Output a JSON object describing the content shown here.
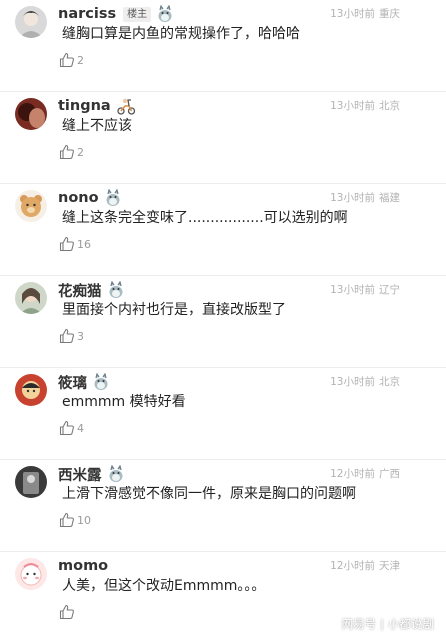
{
  "comments": [
    {
      "name": "narciss",
      "badge": "楼主",
      "time": "13小时前",
      "location": "重庆",
      "text": "缝胸口算是内鱼的常规操作了，哈哈哈",
      "likes": "2",
      "avatar": "avatar-face",
      "icon": "totoro-icon"
    },
    {
      "name": "tingna",
      "badge": "",
      "time": "13小时前",
      "location": "北京",
      "text": "缝上不应该",
      "likes": "2",
      "avatar": "avatar-photo",
      "icon": "scooter-icon"
    },
    {
      "name": "nono",
      "badge": "",
      "time": "13小时前",
      "location": "福建",
      "text": "缝上这条完全变味了.................可以选别的啊",
      "likes": "16",
      "avatar": "avatar-bear",
      "icon": "totoro-icon"
    },
    {
      "name": "花痴猫",
      "badge": "",
      "time": "13小时前",
      "location": "辽宁",
      "text": "里面接个内衬也行是，直接改版型了",
      "likes": "3",
      "avatar": "avatar-person",
      "icon": "totoro-icon"
    },
    {
      "name": "筱璃",
      "badge": "",
      "time": "13小时前",
      "location": "北京",
      "text": "emmmm 模特好看",
      "likes": "4",
      "avatar": "avatar-cartoon",
      "icon": "totoro-icon"
    },
    {
      "name": "西米露",
      "badge": "",
      "time": "12小时前",
      "location": "广西",
      "text": "上滑下滑感觉不像同一件，原来是胸口的问题啊",
      "likes": "10",
      "avatar": "avatar-dark",
      "icon": "totoro-icon"
    },
    {
      "name": "momo",
      "badge": "",
      "time": "12小时前",
      "location": "天津",
      "text": "人美，但这个改动Emmmm。。。",
      "likes": "",
      "avatar": "avatar-pink",
      "icon": ""
    }
  ],
  "watermark": {
    "source": "网易号",
    "separator": "|",
    "account": "小都说剧"
  },
  "colors": {
    "name": "#333333",
    "text": "#222222",
    "meta": "#b3b3b3",
    "divider": "#ececec"
  }
}
